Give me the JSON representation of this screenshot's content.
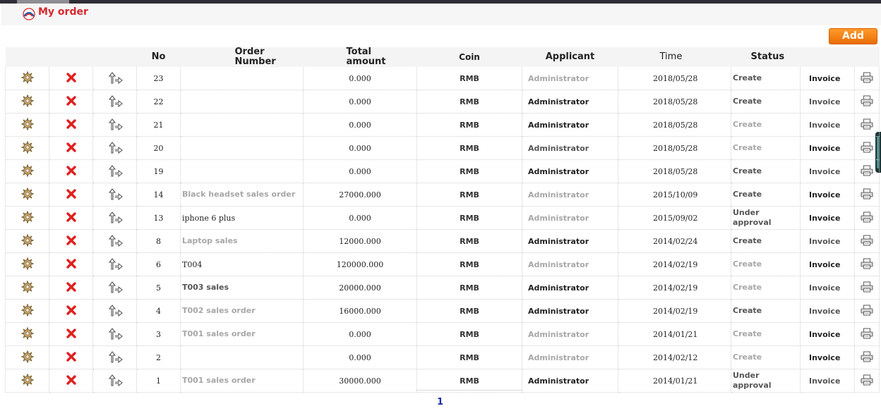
{
  "page": {
    "title": "My order",
    "add_label": "Add",
    "pager_current": "1"
  },
  "table": {
    "headers": [
      "",
      "",
      "",
      "No",
      "Order\nNumber",
      "Total\namount",
      "Coin",
      "Applicant",
      "Time",
      "Status",
      "",
      ""
    ],
    "rows": [
      {
        "no": "23",
        "order": "",
        "amount": "0.000",
        "coin": "RMB",
        "applicant": "Administrator",
        "time": "2018/05/28",
        "status": "Create",
        "invoice": "Invoice",
        "ostyle": "",
        "astyle": "gray",
        "sstyle": "mid",
        "istyle": "dark"
      },
      {
        "no": "22",
        "order": "",
        "amount": "0.000",
        "coin": "RMB",
        "applicant": "Administrator",
        "time": "2018/05/28",
        "status": "Create",
        "invoice": "Invoice",
        "ostyle": "",
        "astyle": "dark",
        "sstyle": "mid",
        "istyle": "mid"
      },
      {
        "no": "21",
        "order": "",
        "amount": "0.000",
        "coin": "RMB",
        "applicant": "Administrator",
        "time": "2018/05/28",
        "status": "Create",
        "invoice": "Invoice",
        "ostyle": "",
        "astyle": "dark",
        "sstyle": "gray",
        "istyle": "mid"
      },
      {
        "no": "20",
        "order": "",
        "amount": "0.000",
        "coin": "RMB",
        "applicant": "Administrator",
        "time": "2018/05/28",
        "status": "Create",
        "invoice": "Invoice",
        "ostyle": "",
        "astyle": "mid",
        "sstyle": "gray",
        "istyle": "dark"
      },
      {
        "no": "19",
        "order": "",
        "amount": "0.000",
        "coin": "RMB",
        "applicant": "Administrator",
        "time": "2018/05/28",
        "status": "Create",
        "invoice": "Invoice",
        "ostyle": "",
        "astyle": "dark",
        "sstyle": "mid",
        "istyle": "mid"
      },
      {
        "no": "14",
        "order": "Black headset sales order",
        "amount": "27000.000",
        "coin": "RMB",
        "applicant": "Administrator",
        "time": "2015/10/09",
        "status": "Create",
        "invoice": "Invoice",
        "ostyle": "gray",
        "astyle": "gray",
        "sstyle": "mid",
        "istyle": "dark"
      },
      {
        "no": "13",
        "order": "iphone 6 plus",
        "amount": "0.000",
        "coin": "RMB",
        "applicant": "Administrator",
        "time": "2015/09/02",
        "status": "Under approval",
        "invoice": "Invoice",
        "ostyle": "mono",
        "astyle": "gray",
        "sstyle": "mid",
        "istyle": "dark"
      },
      {
        "no": "8",
        "order": "Laptop sales",
        "amount": "12000.000",
        "coin": "RMB",
        "applicant": "Administrator",
        "time": "2014/02/24",
        "status": "Create",
        "invoice": "Invoice",
        "ostyle": "gray",
        "astyle": "dark",
        "sstyle": "mid",
        "istyle": "mid"
      },
      {
        "no": "6",
        "order": "T004",
        "amount": "120000.000",
        "coin": "RMB",
        "applicant": "Administrator",
        "time": "2014/02/19",
        "status": "Create",
        "invoice": "Invoice",
        "ostyle": "mono",
        "astyle": "gray",
        "sstyle": "gray",
        "istyle": "dark"
      },
      {
        "no": "5",
        "order": "T003 sales",
        "amount": "20000.000",
        "coin": "RMB",
        "applicant": "Administrator",
        "time": "2014/02/19",
        "status": "Create",
        "invoice": "Invoice",
        "ostyle": "mid",
        "astyle": "dark",
        "sstyle": "gray",
        "istyle": "mid"
      },
      {
        "no": "4",
        "order": "T002 sales order",
        "amount": "16000.000",
        "coin": "RMB",
        "applicant": "Administrator",
        "time": "2014/02/19",
        "status": "Create",
        "invoice": "Invoice",
        "ostyle": "gray",
        "astyle": "dark",
        "sstyle": "mid",
        "istyle": "mid"
      },
      {
        "no": "3",
        "order": "T001 sales order",
        "amount": "0.000",
        "coin": "RMB",
        "applicant": "Administrator",
        "time": "2014/01/21",
        "status": "Create",
        "invoice": "Invoice",
        "ostyle": "gray",
        "astyle": "gray",
        "sstyle": "gray",
        "istyle": "dark"
      },
      {
        "no": "2",
        "order": "",
        "amount": "0.000",
        "coin": "RMB",
        "applicant": "Administrator",
        "time": "2014/02/12",
        "status": "Create",
        "invoice": "Invoice",
        "ostyle": "",
        "astyle": "gray",
        "sstyle": "gray",
        "istyle": "dark"
      },
      {
        "no": "1",
        "order": "T001 sales order",
        "amount": "30000.000",
        "coin": "RMB",
        "applicant": "Administrator",
        "time": "2014/01/21",
        "status": "Under approval",
        "invoice": "Invoice",
        "ostyle": "gray",
        "astyle": "dark",
        "sstyle": "mid",
        "istyle": "mid"
      }
    ],
    "row_icons": {
      "edit": "gear-icon",
      "delete": "delete-x-icon",
      "flow": "workflow-arrows-icon",
      "print": "printer-icon"
    }
  },
  "colors": {
    "title": "#d7282f",
    "add_button": "#f07a10",
    "delete": "#e02020",
    "pager": "#1a2ea8"
  }
}
